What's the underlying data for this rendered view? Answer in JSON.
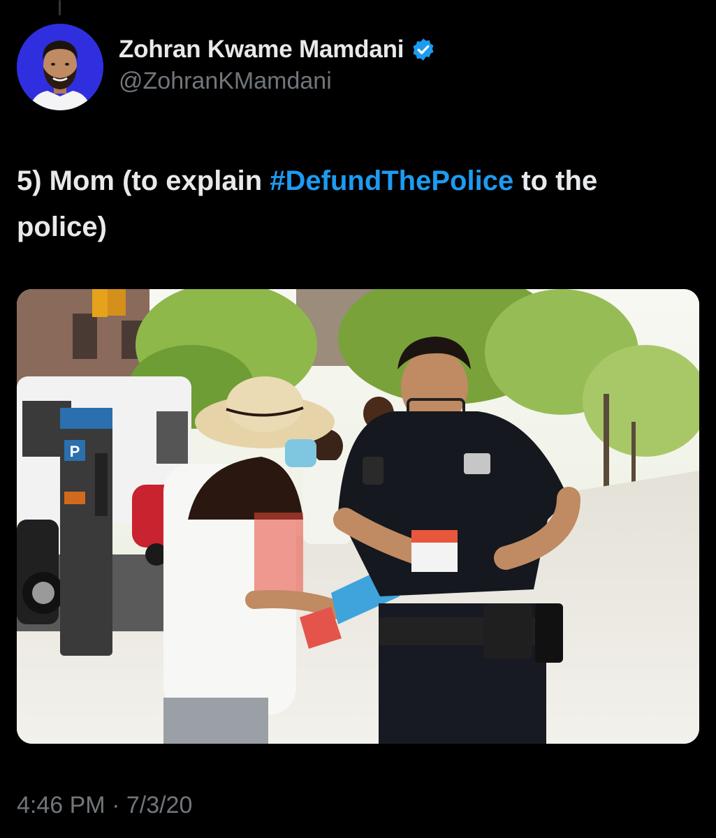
{
  "author": {
    "display_name": "Zohran Kwame Mamdani",
    "handle": "@ZohranKMamdani",
    "avatar_bg": "#2f2fe0",
    "verified_color": "#1d9bf0",
    "verified_icon": "verified-badge-icon"
  },
  "tweet": {
    "text_before": "5) Mom (to explain ",
    "hashtag": "#DefundThePolice",
    "text_after": " to the police)",
    "hashtag_color": "#1d9bf0"
  },
  "media": {
    "parking_sign": "P"
  },
  "meta": {
    "time": "4:46 PM",
    "separator": " · ",
    "date": "7/3/20"
  }
}
